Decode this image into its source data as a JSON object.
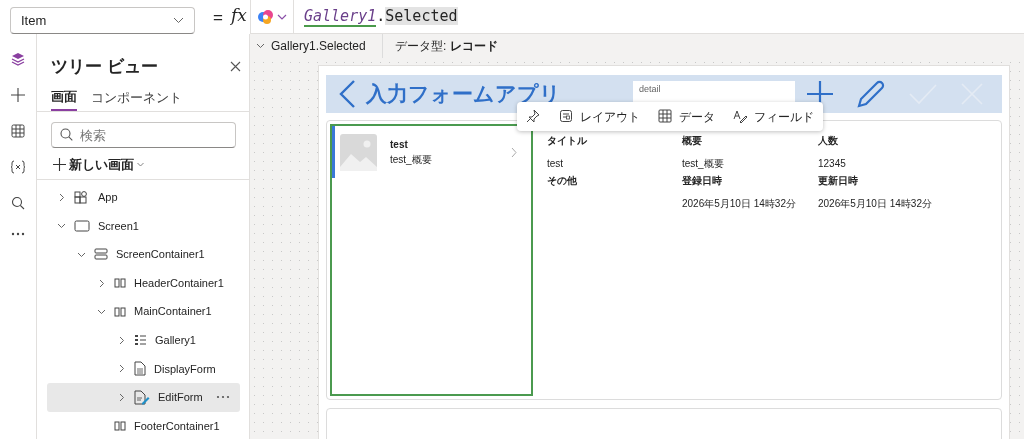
{
  "property_selector": {
    "value": "Item"
  },
  "formula_bar": {
    "equals": "=",
    "fx": "fx",
    "tokens": [
      {
        "text": "Gallery1",
        "kind": "identifier"
      },
      {
        "text": ".",
        "kind": "operator"
      },
      {
        "text": "Selected",
        "kind": "property"
      }
    ]
  },
  "result_bar": {
    "expression": "Gallery1.Selected",
    "data_type": "データ型: **レコード**"
  },
  "left_rail": [
    {
      "kind": "layers",
      "selected": true
    },
    {
      "kind": "insert",
      "selected": false
    },
    {
      "kind": "data",
      "selected": false
    },
    {
      "kind": "variables",
      "selected": false
    },
    {
      "kind": "search",
      "selected": false
    },
    {
      "kind": "more",
      "selected": false
    }
  ],
  "tree_view": {
    "title": "ツリー ビュー",
    "tabs": [
      {
        "label": "画面",
        "selected": true
      },
      {
        "label": "コンポーネント",
        "selected": false
      }
    ],
    "search": {
      "placeholder": "検索"
    },
    "new_screen": "新しい画面",
    "items": [
      {
        "label": "App",
        "kind": "app",
        "expanded": false,
        "selected": false
      },
      {
        "label": "Screen1",
        "kind": "screen",
        "expanded": true,
        "selected": false,
        "children": [
          {
            "label": "ScreenContainer1",
            "kind": "vertical-container",
            "expanded": true,
            "selected": false,
            "children": [
              {
                "label": "HeaderContainer1",
                "kind": "horizontal-container",
                "expanded": false,
                "selected": false
              },
              {
                "label": "MainContainer1",
                "kind": "horizontal-container",
                "expanded": true,
                "selected": false,
                "children": [
                  {
                    "label": "Gallery1",
                    "kind": "gallery",
                    "expanded": false,
                    "selected": false
                  },
                  {
                    "label": "DisplayForm",
                    "kind": "display-form",
                    "expanded": false,
                    "selected": false
                  },
                  {
                    "label": "EditForm",
                    "kind": "edit-form",
                    "expanded": false,
                    "selected": true
                  }
                ]
              },
              {
                "label": "FooterContainer1",
                "kind": "horizontal-container",
                "selected": false
              }
            ]
          }
        ]
      }
    ]
  },
  "canvas": {
    "header": {
      "title": "入力フォームアプリ",
      "field_value": "detail",
      "actions": [
        {
          "kind": "add",
          "disabled": false
        },
        {
          "kind": "edit",
          "disabled": false
        },
        {
          "kind": "save",
          "disabled": true
        },
        {
          "kind": "cancel",
          "disabled": true
        }
      ]
    },
    "toolbar": [
      {
        "kind": "pin"
      },
      {
        "kind": "layout",
        "label": "レイアウト"
      },
      {
        "kind": "data",
        "label": "データ"
      },
      {
        "kind": "fields",
        "label": "フィールド"
      }
    ],
    "gallery": {
      "items": [
        {
          "title": "test",
          "subtitle": "test_概要",
          "selected": true
        }
      ]
    },
    "form": {
      "fields": [
        {
          "label": "タイトル",
          "value": "test"
        },
        {
          "label": "概要",
          "value": "test_概要"
        },
        {
          "label": "人数",
          "value": "12345"
        },
        {
          "label": "その他"
        },
        {
          "label": "登録日時",
          "value": "2026年5月10日 14時32分"
        },
        {
          "label": "更新日時",
          "value": "2026年5月10日 14時32分"
        }
      ]
    }
  }
}
